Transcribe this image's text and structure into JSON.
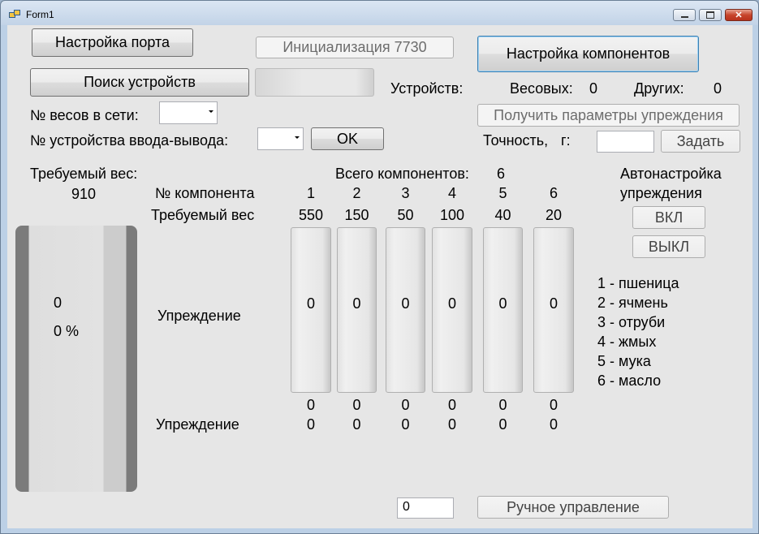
{
  "window": {
    "title": "Form1"
  },
  "buttons": {
    "port_settings": "Настройка порта",
    "init": "Инициализация 7730",
    "components_settings": "Настройка компонентов",
    "device_search": "Поиск устройств",
    "get_params": "Получить параметры упреждения",
    "ok": "OK",
    "set": "Задать",
    "on": "ВКЛ",
    "off": "ВЫКЛ",
    "manual": "Ручное управление"
  },
  "labels": {
    "devices": "Устройств:",
    "weighing": "Весовых:",
    "weighing_count": "0",
    "others": "Других:",
    "others_count": "0",
    "scale_no": "№ весов в сети:",
    "io_device_no": "№ устройства ввода-вывода:",
    "accuracy": "Точность,",
    "accuracy_unit": "г:",
    "required_weight": "Требуемый вес:",
    "required_weight_value": "910",
    "total_components": "Всего компонентов:",
    "total_components_value": "6",
    "auto_setup_line1": "Автонастройка",
    "auto_setup_line2": "упреждения",
    "component_no": "№ компонента",
    "component_required_weight": "Требуемый вес",
    "lead1": "Упреждение",
    "lead2": "Упреждение",
    "big_value": "0",
    "big_percent": "0 %"
  },
  "inputs": {
    "accuracy_value": "",
    "manual_value": "0",
    "scale_no": "",
    "io_device_no": ""
  },
  "components": [
    {
      "no": "1",
      "weight": "550",
      "bar_value": "0",
      "row1": "0",
      "row2": "0"
    },
    {
      "no": "2",
      "weight": "150",
      "bar_value": "0",
      "row1": "0",
      "row2": "0"
    },
    {
      "no": "3",
      "weight": "50",
      "bar_value": "0",
      "row1": "0",
      "row2": "0"
    },
    {
      "no": "4",
      "weight": "100",
      "bar_value": "0",
      "row1": "0",
      "row2": "0"
    },
    {
      "no": "5",
      "weight": "40",
      "bar_value": "0",
      "row1": "0",
      "row2": "0"
    },
    {
      "no": "6",
      "weight": "20",
      "bar_value": "0",
      "row1": "0",
      "row2": "0"
    }
  ],
  "legend": [
    "1 - пшеница",
    "2 - ячмень",
    "3 - отруби",
    "4 - жмых",
    "5 - мука",
    "6 - масло"
  ]
}
